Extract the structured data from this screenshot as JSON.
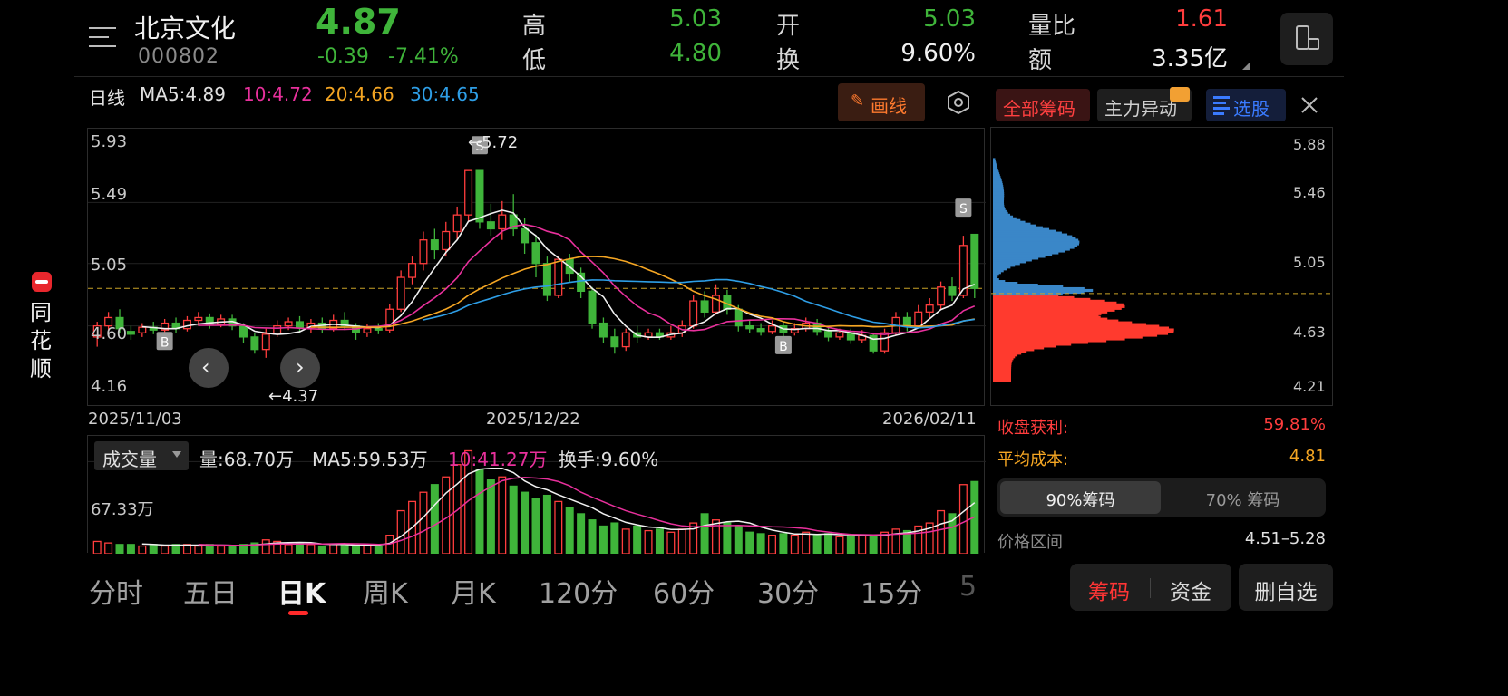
{
  "header": {
    "stock_name": "北京文化",
    "stock_code": "000802",
    "price": "4.87",
    "change": "-0.39",
    "change_pct": "-7.41%",
    "high_label": "高",
    "high": "5.03",
    "low_label": "低",
    "low": "4.80",
    "open_label": "开",
    "open": "5.03",
    "turnover_label": "换",
    "turnover": "9.60%",
    "vol_ratio_label": "量比",
    "vol_ratio": "1.61",
    "amount_label": "额",
    "amount": "3.35亿",
    "menu_icon": "menu-icon",
    "landscape_icon": "rotate-device-icon"
  },
  "sidebar": {
    "brand": "同花顺"
  },
  "ma_bar": {
    "period": "日线",
    "ma5": "MA5:4.89",
    "ma10": "10:4.72",
    "ma20": "20:4.66",
    "ma30": "30:4.65",
    "draw_button": "画线",
    "settings_icon": "hexagon-settings-icon"
  },
  "chips_toolbar": {
    "all_chips": "全部筹码",
    "main_force": "主力异动",
    "stock_pick": "选股",
    "close_icon": "close-icon"
  },
  "price_axis": {
    "top": "5.93",
    "l2": "5.49",
    "l3": "5.05",
    "l4": "4.60",
    "bottom": "4.16"
  },
  "annotations": {
    "max_label": "←5.72",
    "min_label": "←4.37"
  },
  "dates": {
    "start": "2025/11/03",
    "mid": "2025/12/22",
    "end": "2026/02/11"
  },
  "volume_bar": {
    "selector": "成交量",
    "vol": "量:68.70万",
    "ma5": "MA5:59.53万",
    "ma10": "10:41.27万",
    "turnover": "换手:9.60%",
    "axis_label": "67.33万"
  },
  "chips_panel": {
    "prices": [
      "5.88",
      "5.46",
      "5.05",
      "4.63",
      "4.21"
    ],
    "profit_label": "收盘获利:",
    "profit_value": "59.81%",
    "avg_cost_label": "平均成本:",
    "avg_cost_value": "4.81",
    "tab_90": "90%筹码",
    "tab_70": "70% 筹码",
    "range_label": "价格区间",
    "range_value": "4.51–5.28"
  },
  "tabs": [
    "分时",
    "五日",
    "日K",
    "周K",
    "月K",
    "120分",
    "60分",
    "30分",
    "15分",
    "5"
  ],
  "bottom_buttons": {
    "chips": "筹码",
    "funds": "资金",
    "remove": "删自选"
  },
  "colors": {
    "up": "#ff3d3d",
    "down": "#3fb43a",
    "ma5": "#f0f0f0",
    "ma10": "#e8309c",
    "ma20": "#f5a623",
    "ma30": "#2e9ee6",
    "chips_blue": "#3a87c8",
    "chips_red": "#ff3a2e"
  },
  "chart_data": {
    "type": "candlestick",
    "x_start": "2025/11/03",
    "x_end": "2026/02/11",
    "ylim": [
      4.16,
      5.93
    ],
    "candles": [
      [
        4.52,
        4.6,
        4.63,
        4.45
      ],
      [
        4.6,
        4.66,
        4.7,
        4.56
      ],
      [
        4.66,
        4.58,
        4.72,
        4.55
      ],
      [
        4.56,
        4.54,
        4.6,
        4.5
      ],
      [
        4.55,
        4.59,
        4.62,
        4.52
      ],
      [
        4.59,
        4.57,
        4.63,
        4.54
      ],
      [
        4.57,
        4.62,
        4.65,
        4.55
      ],
      [
        4.62,
        4.58,
        4.66,
        4.55
      ],
      [
        4.58,
        4.64,
        4.67,
        4.56
      ],
      [
        4.64,
        4.66,
        4.7,
        4.6
      ],
      [
        4.66,
        4.61,
        4.69,
        4.58
      ],
      [
        4.61,
        4.65,
        4.68,
        4.59
      ],
      [
        4.65,
        4.6,
        4.68,
        4.57
      ],
      [
        4.6,
        4.52,
        4.62,
        4.48
      ],
      [
        4.52,
        4.43,
        4.55,
        4.4
      ],
      [
        4.43,
        4.54,
        4.58,
        4.37
      ],
      [
        4.54,
        4.6,
        4.64,
        4.52
      ],
      [
        4.6,
        4.63,
        4.66,
        4.57
      ],
      [
        4.63,
        4.59,
        4.67,
        4.56
      ],
      [
        4.59,
        4.62,
        4.65,
        4.55
      ],
      [
        4.62,
        4.58,
        4.66,
        4.55
      ],
      [
        4.58,
        4.64,
        4.68,
        4.56
      ],
      [
        4.64,
        4.6,
        4.7,
        4.57
      ],
      [
        4.6,
        4.55,
        4.62,
        4.5
      ],
      [
        4.55,
        4.58,
        4.61,
        4.52
      ],
      [
        4.58,
        4.57,
        4.62,
        4.54
      ],
      [
        4.57,
        4.72,
        4.76,
        4.55
      ],
      [
        4.72,
        4.95,
        5.0,
        4.7
      ],
      [
        4.95,
        5.05,
        5.1,
        4.9
      ],
      [
        5.05,
        5.22,
        5.28,
        5.0
      ],
      [
        5.22,
        5.15,
        5.3,
        5.08
      ],
      [
        5.15,
        5.28,
        5.35,
        5.1
      ],
      [
        5.28,
        5.4,
        5.46,
        5.22
      ],
      [
        5.4,
        5.72,
        5.72,
        5.35
      ],
      [
        5.72,
        5.35,
        5.7,
        5.3
      ],
      [
        5.35,
        5.3,
        5.48,
        5.25
      ],
      [
        5.3,
        5.4,
        5.5,
        5.22
      ],
      [
        5.4,
        5.3,
        5.55,
        5.25
      ],
      [
        5.3,
        5.2,
        5.38,
        5.12
      ],
      [
        5.2,
        5.05,
        5.25,
        4.95
      ],
      [
        5.05,
        4.82,
        5.1,
        4.78
      ],
      [
        4.82,
        5.08,
        5.1,
        4.8
      ],
      [
        5.08,
        4.98,
        5.12,
        4.92
      ],
      [
        4.98,
        4.85,
        5.02,
        4.8
      ],
      [
        4.85,
        4.62,
        4.88,
        4.58
      ],
      [
        4.62,
        4.52,
        4.66,
        4.48
      ],
      [
        4.52,
        4.45,
        4.58,
        4.4
      ],
      [
        4.45,
        4.55,
        4.58,
        4.42
      ],
      [
        4.55,
        4.52,
        4.6,
        4.48
      ],
      [
        4.52,
        4.55,
        4.58,
        4.5
      ],
      [
        4.55,
        4.52,
        4.58,
        4.5
      ],
      [
        4.52,
        4.55,
        4.6,
        4.5
      ],
      [
        4.55,
        4.6,
        4.64,
        4.52
      ],
      [
        4.6,
        4.78,
        4.82,
        4.58
      ],
      [
        4.78,
        4.7,
        4.85,
        4.66
      ],
      [
        4.7,
        4.82,
        4.9,
        4.68
      ],
      [
        4.82,
        4.72,
        4.86,
        4.68
      ],
      [
        4.72,
        4.6,
        4.75,
        4.56
      ],
      [
        4.6,
        4.58,
        4.64,
        4.55
      ],
      [
        4.58,
        4.56,
        4.62,
        4.53
      ],
      [
        4.56,
        4.6,
        4.64,
        4.54
      ],
      [
        4.6,
        4.55,
        4.63,
        4.52
      ],
      [
        4.55,
        4.58,
        4.62,
        4.53
      ],
      [
        4.58,
        4.62,
        4.66,
        4.56
      ],
      [
        4.62,
        4.56,
        4.65,
        4.53
      ],
      [
        4.56,
        4.52,
        4.6,
        4.49
      ],
      [
        4.52,
        4.55,
        4.58,
        4.5
      ],
      [
        4.55,
        4.5,
        4.58,
        4.47
      ],
      [
        4.5,
        4.53,
        4.57,
        4.48
      ],
      [
        4.53,
        4.42,
        4.55,
        4.4
      ],
      [
        4.42,
        4.55,
        4.58,
        4.4
      ],
      [
        4.55,
        4.66,
        4.7,
        4.53
      ],
      [
        4.66,
        4.6,
        4.7,
        4.56
      ],
      [
        4.6,
        4.7,
        4.75,
        4.58
      ],
      [
        4.7,
        4.75,
        4.8,
        4.66
      ],
      [
        4.75,
        4.88,
        4.92,
        4.72
      ],
      [
        4.88,
        4.82,
        4.95,
        4.78
      ],
      [
        4.82,
        5.18,
        5.25,
        4.8
      ],
      [
        5.26,
        4.87,
        5.03,
        4.8
      ]
    ],
    "volume": [
      8,
      7,
      6,
      6,
      5,
      6,
      5,
      6,
      6,
      5,
      6,
      5,
      5,
      6,
      7,
      9,
      8,
      6,
      7,
      6,
      5,
      6,
      6,
      5,
      6,
      5,
      12,
      28,
      34,
      40,
      45,
      50,
      58,
      67,
      55,
      48,
      50,
      44,
      40,
      36,
      38,
      34,
      30,
      26,
      22,
      18,
      20,
      16,
      18,
      15,
      16,
      14,
      16,
      20,
      26,
      22,
      20,
      18,
      14,
      13,
      12,
      13,
      12,
      14,
      12,
      13,
      11,
      12,
      12,
      11,
      14,
      16,
      15,
      18,
      20,
      28,
      26,
      45,
      47
    ],
    "ma_last": {
      "ma5": 4.89,
      "ma10": 4.72,
      "ma20": 4.66,
      "ma30": 4.65
    },
    "signals": [
      {
        "type": "B",
        "index": 6
      },
      {
        "type": "S",
        "index": 34
      },
      {
        "type": "B",
        "index": 61
      },
      {
        "type": "S",
        "index": 77
      }
    ],
    "chip_peak_price": 4.63
  }
}
